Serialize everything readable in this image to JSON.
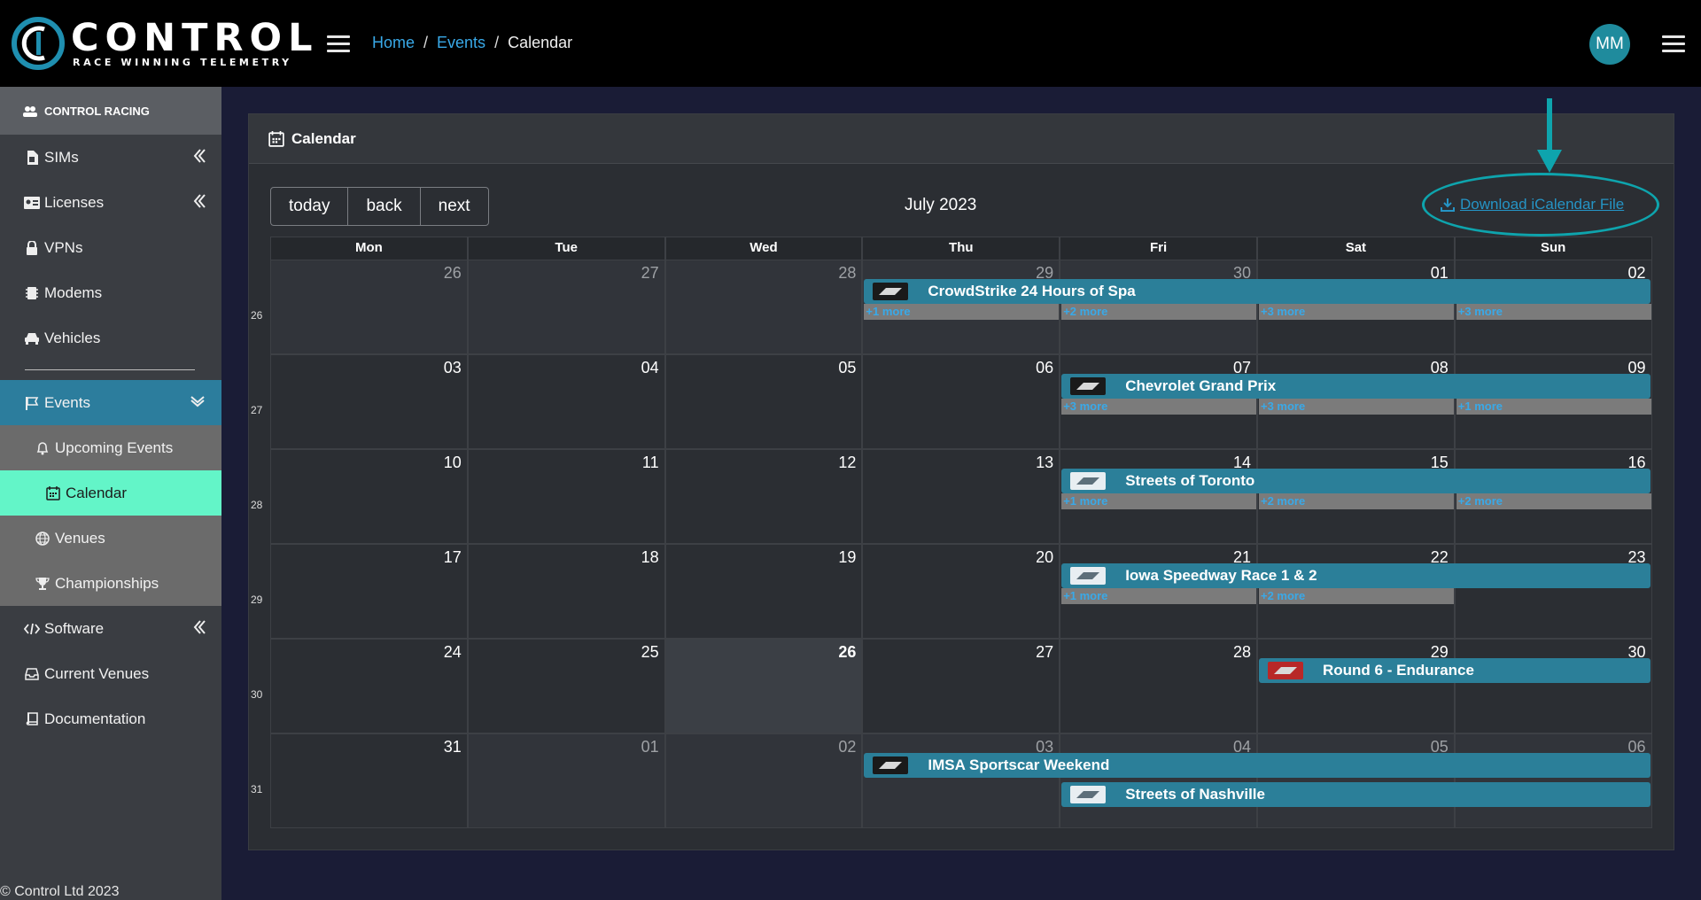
{
  "app": {
    "logo_word": "CONTROL",
    "logo_tagline": "RACE WINNING TELEMETRY",
    "brand_color": "#2c7d9d",
    "accent_color": "#63f5c8"
  },
  "header": {
    "breadcrumb": [
      "Home",
      "Events",
      "Calendar"
    ],
    "avatar_initials": "MM"
  },
  "sidebar": {
    "org": "CONTROL RACING",
    "items": [
      {
        "label": "SIMs",
        "icon": "sim-card-icon",
        "chevron": true
      },
      {
        "label": "Licenses",
        "icon": "id-card-icon",
        "chevron": true
      },
      {
        "label": "VPNs",
        "icon": "lock-icon",
        "chevron": false
      },
      {
        "label": "Modems",
        "icon": "chip-icon",
        "chevron": false
      },
      {
        "label": "Vehicles",
        "icon": "car-icon",
        "chevron": false
      }
    ],
    "events": {
      "label": "Events",
      "icon": "flag-icon"
    },
    "events_children": [
      {
        "label": "Upcoming Events",
        "icon": "bell-icon"
      },
      {
        "label": "Calendar",
        "icon": "calendar-icon"
      },
      {
        "label": "Venues",
        "icon": "globe-icon"
      },
      {
        "label": "Championships",
        "icon": "trophy-icon"
      }
    ],
    "bottom_items": [
      {
        "label": "Software",
        "icon": "code-icon",
        "chevron": true
      },
      {
        "label": "Current Venues",
        "icon": "inbox-icon",
        "chevron": false
      },
      {
        "label": "Documentation",
        "icon": "book-icon",
        "chevron": false
      }
    ],
    "footer": "© Control Ltd 2023"
  },
  "calendar": {
    "card_title": "Calendar",
    "buttons": {
      "today": "today",
      "back": "back",
      "next": "next"
    },
    "month_title": "July 2023",
    "download_label": "Download iCalendar File",
    "dow": [
      "Mon",
      "Tue",
      "Wed",
      "Thu",
      "Fri",
      "Sat",
      "Sun"
    ],
    "weeks": [
      {
        "num": "26",
        "days": [
          "26",
          "27",
          "28",
          "29",
          "30",
          "01",
          "02"
        ],
        "other": [
          true,
          true,
          true,
          true,
          true,
          false,
          false
        ],
        "today": -1
      },
      {
        "num": "27",
        "days": [
          "03",
          "04",
          "05",
          "06",
          "07",
          "08",
          "09"
        ],
        "other": [
          false,
          false,
          false,
          false,
          false,
          false,
          false
        ],
        "today": -1
      },
      {
        "num": "28",
        "days": [
          "10",
          "11",
          "12",
          "13",
          "14",
          "15",
          "16"
        ],
        "other": [
          false,
          false,
          false,
          false,
          false,
          false,
          false
        ],
        "today": -1
      },
      {
        "num": "29",
        "days": [
          "17",
          "18",
          "19",
          "20",
          "21",
          "22",
          "23"
        ],
        "other": [
          false,
          false,
          false,
          false,
          false,
          false,
          false
        ],
        "today": -1
      },
      {
        "num": "30",
        "days": [
          "24",
          "25",
          "26",
          "27",
          "28",
          "29",
          "30"
        ],
        "other": [
          false,
          false,
          false,
          false,
          false,
          false,
          false
        ],
        "today": 2
      },
      {
        "num": "31",
        "days": [
          "31",
          "01",
          "02",
          "03",
          "04",
          "05",
          "06"
        ],
        "other": [
          false,
          true,
          true,
          true,
          true,
          true,
          true
        ],
        "today": -1
      }
    ],
    "events": [
      {
        "title": "CrowdStrike 24 Hours of Spa",
        "week": 0,
        "start": 3,
        "end": 6,
        "row": 0,
        "badge": "dark"
      },
      {
        "title": "Chevrolet Grand Prix",
        "week": 1,
        "start": 4,
        "end": 6,
        "row": 0,
        "badge": "dark"
      },
      {
        "title": "Streets of Toronto",
        "week": 2,
        "start": 4,
        "end": 6,
        "row": 0,
        "badge": "light"
      },
      {
        "title": "Iowa Speedway Race 1 & 2",
        "week": 3,
        "start": 4,
        "end": 6,
        "row": 0,
        "badge": "light"
      },
      {
        "title": "Round 6 - Endurance",
        "week": 4,
        "start": 5,
        "end": 6,
        "row": 0,
        "badge": "red"
      },
      {
        "title": "IMSA Sportscar Weekend",
        "week": 5,
        "start": 3,
        "end": 6,
        "row": 0,
        "badge": "dark"
      },
      {
        "title": "Streets of Nashville",
        "week": 5,
        "start": 4,
        "end": 6,
        "row": 1,
        "badge": "light"
      }
    ],
    "more_links": [
      {
        "week": 0,
        "day": 3,
        "label": "+1 more"
      },
      {
        "week": 0,
        "day": 4,
        "label": "+2 more"
      },
      {
        "week": 0,
        "day": 5,
        "label": "+3 more"
      },
      {
        "week": 0,
        "day": 6,
        "label": "+3 more"
      },
      {
        "week": 1,
        "day": 4,
        "label": "+3 more"
      },
      {
        "week": 1,
        "day": 5,
        "label": "+3 more"
      },
      {
        "week": 1,
        "day": 6,
        "label": "+1 more"
      },
      {
        "week": 2,
        "day": 4,
        "label": "+1 more"
      },
      {
        "week": 2,
        "day": 5,
        "label": "+2 more"
      },
      {
        "week": 2,
        "day": 6,
        "label": "+2 more"
      },
      {
        "week": 3,
        "day": 4,
        "label": "+1 more"
      },
      {
        "week": 3,
        "day": 5,
        "label": "+2 more"
      }
    ]
  }
}
